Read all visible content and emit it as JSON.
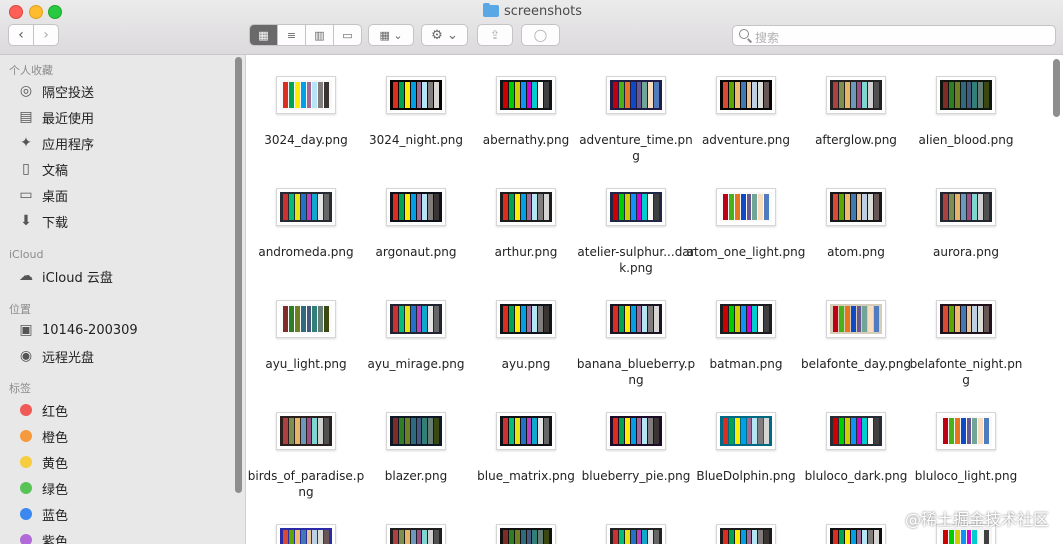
{
  "window": {
    "title": "screenshots"
  },
  "toolbar": {
    "back": "‹",
    "forward": "›",
    "views": [
      "▦",
      "≡",
      "▥",
      "▭"
    ],
    "group_label": "▦ ⌄",
    "action_label": "⚙ ⌄",
    "share_label": "⇪",
    "tag_label": "◯"
  },
  "search": {
    "placeholder": "搜索"
  },
  "sidebar": {
    "favorites_header": "个人收藏",
    "favorites": [
      {
        "label": "隔空投送",
        "icon": "airdrop-icon",
        "glyph": "◎"
      },
      {
        "label": "最近使用",
        "icon": "recents-icon",
        "glyph": "▤"
      },
      {
        "label": "应用程序",
        "icon": "applications-icon",
        "glyph": "✦"
      },
      {
        "label": "文稿",
        "icon": "documents-icon",
        "glyph": "▯"
      },
      {
        "label": "桌面",
        "icon": "desktop-icon",
        "glyph": "▭"
      },
      {
        "label": "下载",
        "icon": "downloads-icon",
        "glyph": "⬇"
      }
    ],
    "icloud_header": "iCloud",
    "icloud": [
      {
        "label": "iCloud 云盘",
        "icon": "cloud-icon",
        "glyph": "☁"
      }
    ],
    "locations_header": "位置",
    "locations": [
      {
        "label": "10146-200309",
        "icon": "disk-icon",
        "glyph": "▣"
      },
      {
        "label": "远程光盘",
        "icon": "optical-disc-icon",
        "glyph": "◉"
      }
    ],
    "tags_header": "标签",
    "tags": [
      {
        "label": "红色",
        "color": "#f05a55"
      },
      {
        "label": "橙色",
        "color": "#f59a3d"
      },
      {
        "label": "黄色",
        "color": "#f5cd3f"
      },
      {
        "label": "绿色",
        "color": "#58c457"
      },
      {
        "label": "蓝色",
        "color": "#3b88f0"
      },
      {
        "label": "紫色",
        "color": "#b06bd8"
      }
    ]
  },
  "files": [
    {
      "name": "3024_day.png",
      "bg": "#f7f7f7"
    },
    {
      "name": "3024_night.png",
      "bg": "#090300"
    },
    {
      "name": "abernathy.png",
      "bg": "#111416"
    },
    {
      "name": "adventure_time.png",
      "bg": "#1f1d45"
    },
    {
      "name": "adventure.png",
      "bg": "#040404"
    },
    {
      "name": "afterglow.png",
      "bg": "#212121"
    },
    {
      "name": "alien_blood.png",
      "bg": "#0f1610"
    },
    {
      "name": "andromeda.png",
      "bg": "#262a33"
    },
    {
      "name": "argonaut.png",
      "bg": "#0e1019"
    },
    {
      "name": "arthur.png",
      "bg": "#1c1c1c"
    },
    {
      "name": "atelier-sulphur...dark.png",
      "bg": "#202746"
    },
    {
      "name": "atom_one_light.png",
      "bg": "#f9f9f9"
    },
    {
      "name": "atom.png",
      "bg": "#161719"
    },
    {
      "name": "aurora.png",
      "bg": "#23262e"
    },
    {
      "name": "ayu_light.png",
      "bg": "#fafafa"
    },
    {
      "name": "ayu_mirage.png",
      "bg": "#1f2430"
    },
    {
      "name": "ayu.png",
      "bg": "#0f1419"
    },
    {
      "name": "banana_blueberry.png",
      "bg": "#191323"
    },
    {
      "name": "batman.png",
      "bg": "#1b1d1e"
    },
    {
      "name": "belafonte_day.png",
      "bg": "#d5ccba"
    },
    {
      "name": "belafonte_night.png",
      "bg": "#20111b"
    },
    {
      "name": "birds_of_paradise.png",
      "bg": "#2a1f1d"
    },
    {
      "name": "blazer.png",
      "bg": "#0d1926"
    },
    {
      "name": "blue_matrix.png",
      "bg": "#101116"
    },
    {
      "name": "blueberry_pie.png",
      "bg": "#1c0c28"
    },
    {
      "name": "BlueDolphin.png",
      "bg": "#006984"
    },
    {
      "name": "bluloco_dark.png",
      "bg": "#282c34"
    },
    {
      "name": "bluloco_light.png",
      "bg": "#f9f9f9"
    },
    {
      "name": "",
      "bg": "#2b2ba8"
    },
    {
      "name": "",
      "bg": "#1e1e1e"
    },
    {
      "name": "",
      "bg": "#111111"
    },
    {
      "name": "",
      "bg": "#222222"
    },
    {
      "name": "",
      "bg": "#1b1b1b"
    },
    {
      "name": "",
      "bg": "#101010"
    },
    {
      "name": "",
      "bg": "#f4f4f4"
    }
  ],
  "palettes": [
    [
      "#db2d20",
      "#01a252",
      "#fded02",
      "#01a0e4",
      "#a16a94",
      "#b5e4f4",
      "#807d7c",
      "#3a3432"
    ],
    [
      "#db2d20",
      "#01a252",
      "#fded02",
      "#01a0e4",
      "#a16a94",
      "#b5e4f4",
      "#807d7c",
      "#d6d5d4"
    ],
    [
      "#cd0000",
      "#00cd00",
      "#cdcd00",
      "#1093f5",
      "#cd00cd",
      "#00cdcd",
      "#faf9f6",
      "#404040"
    ],
    [
      "#bd0013",
      "#4ab118",
      "#e7741e",
      "#0f4ac6",
      "#665993",
      "#70a598",
      "#f8dcc0",
      "#4e7cbf"
    ],
    [
      "#d84a33",
      "#5da602",
      "#eebb6e",
      "#417ab3",
      "#e5c499",
      "#bdcfe5",
      "#dbded8",
      "#685656"
    ],
    [
      "#ac4142",
      "#7e8e50",
      "#e5b567",
      "#6c99bb",
      "#9f4e85",
      "#7dd6cf",
      "#d0d0d0",
      "#505050"
    ],
    [
      "#7f2b27",
      "#2f7e25",
      "#717f24",
      "#2f6a7f",
      "#47587f",
      "#327f77",
      "#647d75",
      "#3c4812"
    ],
    [
      "#cd3131",
      "#05bc79",
      "#e5e512",
      "#2472c8",
      "#bc3fbc",
      "#0fa8cd",
      "#e5e5e5",
      "#666666"
    ]
  ],
  "watermark": "@稀土掘金技术社区"
}
